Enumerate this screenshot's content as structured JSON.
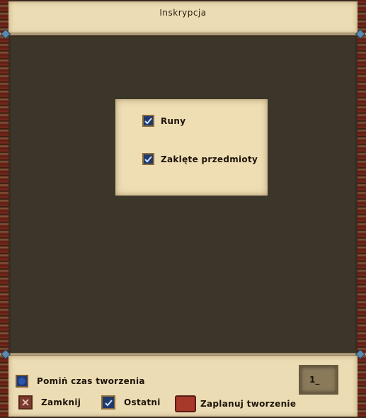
{
  "window": {
    "title": "Inskrypcja"
  },
  "filters": [
    {
      "label": "Runy",
      "checked": true
    },
    {
      "label": "Zaklęte przedmioty",
      "checked": true
    }
  ],
  "footer": {
    "skip_time_label": "Pomiń czas tworzenia",
    "close_label": "Zamknij",
    "last_label": "Ostatni",
    "schedule_label": "Zaplanuj tworzenie",
    "quantity_value": "1_"
  },
  "colors": {
    "parchment": "#ecdcb4",
    "dark_panel": "#3b3629",
    "checkbox_blue": "#1f3a6a"
  }
}
